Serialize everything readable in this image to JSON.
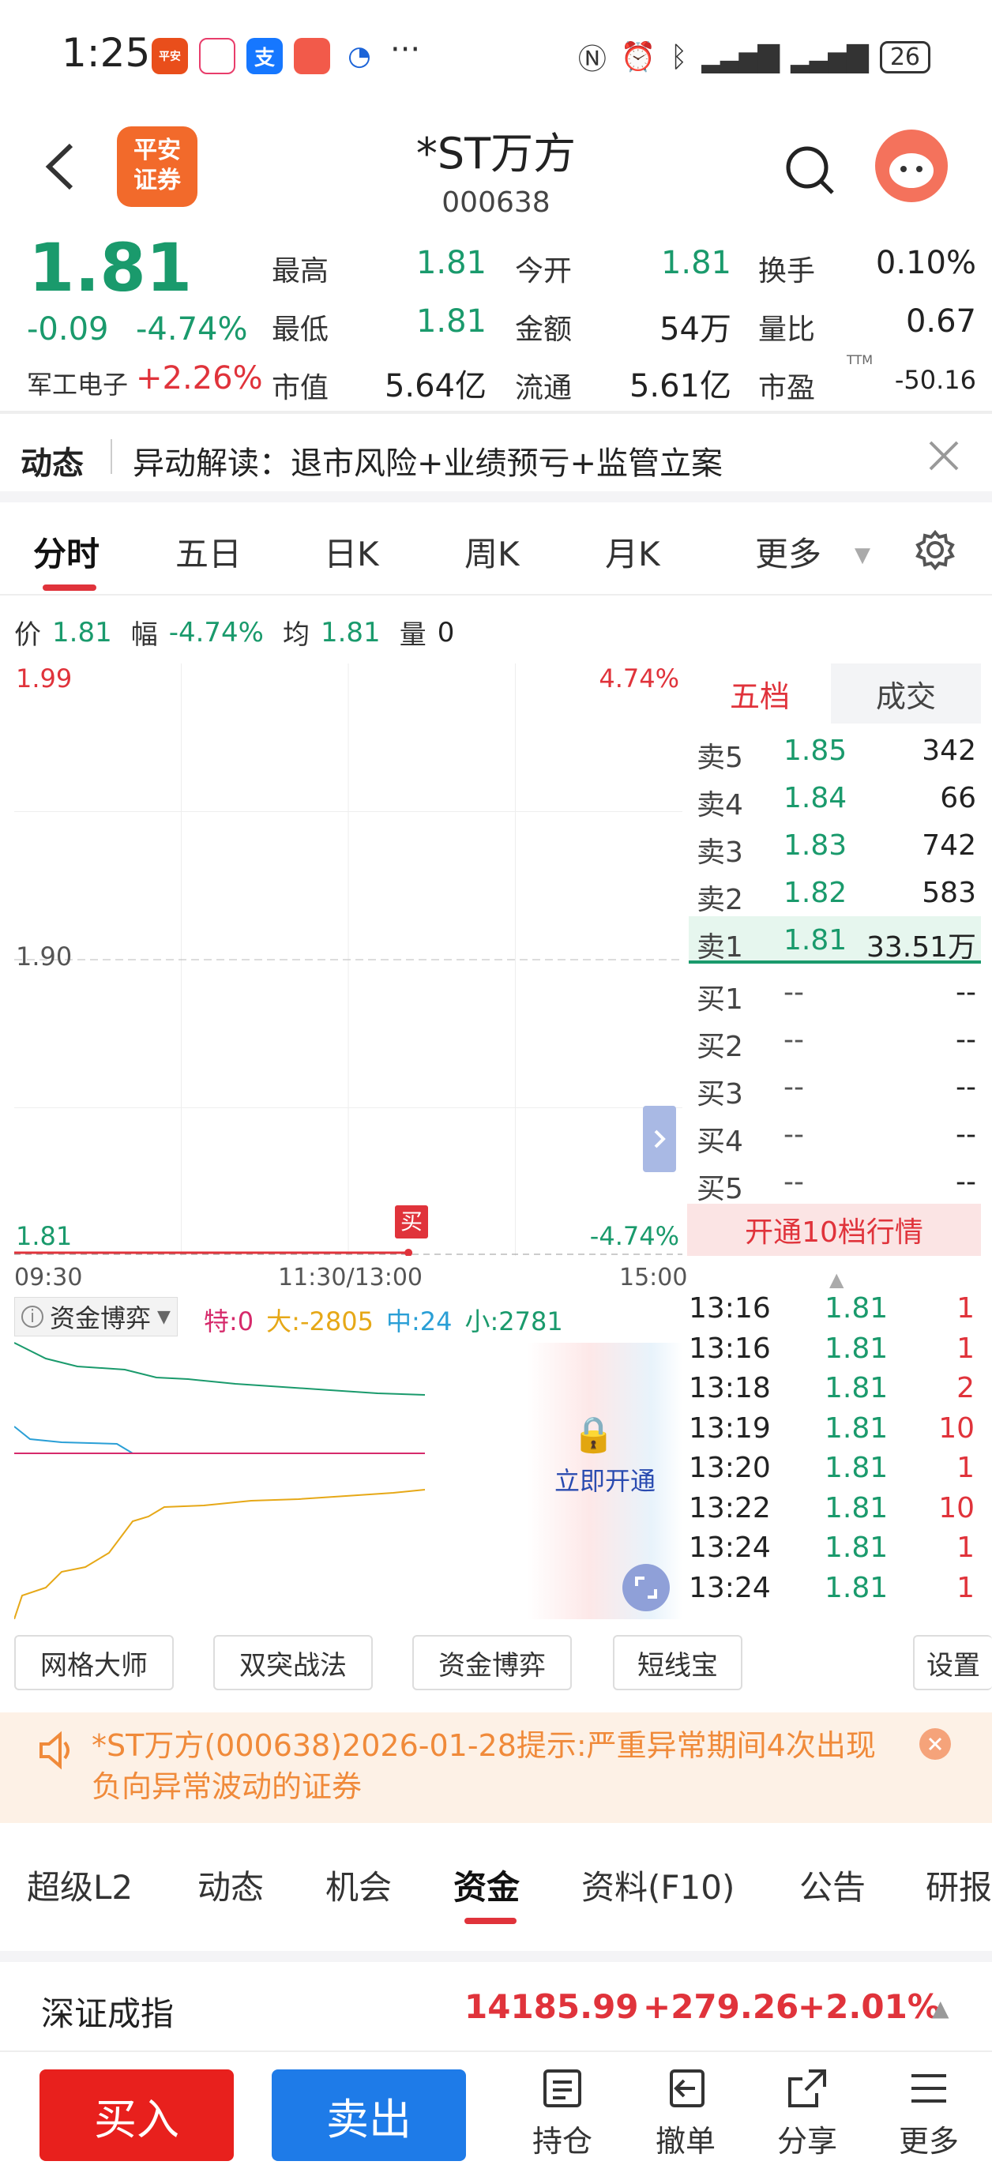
{
  "status": {
    "time": "1:25",
    "dots": "···",
    "battery": "26",
    "apps": [
      {
        "label": "平安证券",
        "color": "#e94e1b"
      },
      {
        "label": "",
        "color": "#e83d6b"
      },
      {
        "label": "支",
        "color": "#1677ff"
      },
      {
        "label": "",
        "color": "#f25a4a"
      },
      {
        "label": "",
        "color": "#1c64d8"
      }
    ]
  },
  "header": {
    "logo": "平安\n证券",
    "title": "*ST万方",
    "code": "000638"
  },
  "quote": {
    "price": "1.81",
    "change": "-0.09",
    "change_pct": "-4.74%",
    "sector_name": "军工电子",
    "sector_pct": "+2.26%",
    "cols": [
      [
        {
          "label": "最高",
          "value": "1.81"
        },
        {
          "label": "最低",
          "value": "1.81"
        },
        {
          "label": "市值",
          "value": "5.64亿"
        }
      ],
      [
        {
          "label": "今开",
          "value": "1.81"
        },
        {
          "label": "金额",
          "value": "54万"
        },
        {
          "label": "流通",
          "value": "5.61亿"
        }
      ],
      [
        {
          "label": "换手",
          "value": "0.10%"
        },
        {
          "label": "量比",
          "value": "0.67"
        },
        {
          "label": "市盈",
          "value": "-50.16",
          "sup": "TTM"
        }
      ]
    ]
  },
  "news": {
    "tag": "动态",
    "text": "异动解读：退市风险+业绩预亏+监管立案"
  },
  "chart_tabs": [
    "分时",
    "五日",
    "日K",
    "周K",
    "月K",
    "更多"
  ],
  "info_bar": {
    "price_label": "价",
    "price": "1.81",
    "range_label": "幅",
    "range": "-4.74%",
    "avg_label": "均",
    "avg": "1.81",
    "vol_label": "量",
    "vol": "0"
  },
  "chart_data": {
    "type": "line",
    "title": "",
    "y_labels": {
      "top": "1.99",
      "mid": "1.90",
      "bottom": "1.81"
    },
    "pct_labels": {
      "top": "4.74%",
      "bottom": "-4.74%"
    },
    "x_labels": [
      "09:30",
      "11:30/13:00",
      "15:00"
    ],
    "ylim": [
      1.81,
      1.99
    ],
    "series": [
      {
        "values": [
          1.81,
          1.81,
          1.81,
          1.81
        ]
      }
    ],
    "buy_marker": "买"
  },
  "orderbook": {
    "tabs": [
      "五档",
      "成交"
    ],
    "rows": [
      {
        "label": "卖5",
        "price": "1.85",
        "vol": "342"
      },
      {
        "label": "卖4",
        "price": "1.84",
        "vol": "66"
      },
      {
        "label": "卖3",
        "price": "1.83",
        "vol": "742"
      },
      {
        "label": "卖2",
        "price": "1.82",
        "vol": "583"
      },
      {
        "label": "卖1",
        "price": "1.81",
        "vol": "33.51万"
      },
      {
        "label": "买1",
        "price": "--",
        "vol": "--"
      },
      {
        "label": "买2",
        "price": "--",
        "vol": "--"
      },
      {
        "label": "买3",
        "price": "--",
        "vol": "--"
      },
      {
        "label": "买4",
        "price": "--",
        "vol": "--"
      },
      {
        "label": "买5",
        "price": "--",
        "vol": "--"
      }
    ],
    "upgrade": "开通10档行情"
  },
  "capital": {
    "title": "资金博弈",
    "te": "特:0",
    "da": "大:-2805",
    "zhong": "中:24",
    "xiao": "小:2781",
    "lock_text": "立即开通"
  },
  "trades": [
    {
      "time": "13:16",
      "price": "1.81",
      "vol": "1"
    },
    {
      "time": "13:16",
      "price": "1.81",
      "vol": "1"
    },
    {
      "time": "13:18",
      "price": "1.81",
      "vol": "2"
    },
    {
      "time": "13:19",
      "price": "1.81",
      "vol": "10"
    },
    {
      "time": "13:20",
      "price": "1.81",
      "vol": "1"
    },
    {
      "time": "13:22",
      "price": "1.81",
      "vol": "10"
    },
    {
      "time": "13:24",
      "price": "1.81",
      "vol": "1"
    },
    {
      "time": "13:24",
      "price": "1.81",
      "vol": "1"
    }
  ],
  "tools": [
    "网格大师",
    "双突战法",
    "资金博弈",
    "短线宝",
    "设置"
  ],
  "notice": {
    "text": "*ST万方(000638)2026-01-28提示:严重异常期间4次出现负向异常波动的证券"
  },
  "bottom_tabs": [
    "超级L2",
    "动态",
    "机会",
    "资金",
    "资料(F10)",
    "公告",
    "研报"
  ],
  "index": {
    "name": "深证成指",
    "value": "14185.99",
    "change": "+279.26",
    "pct": "+2.01%"
  },
  "actions": {
    "buy": "买入",
    "sell": "卖出",
    "nav": [
      "持仓",
      "撤单",
      "分享",
      "更多"
    ]
  },
  "colors": {
    "up": "#e0333b",
    "down": "#1a9a6c",
    "buy_btn": "#e8201d",
    "sell_btn": "#1e7be8"
  }
}
